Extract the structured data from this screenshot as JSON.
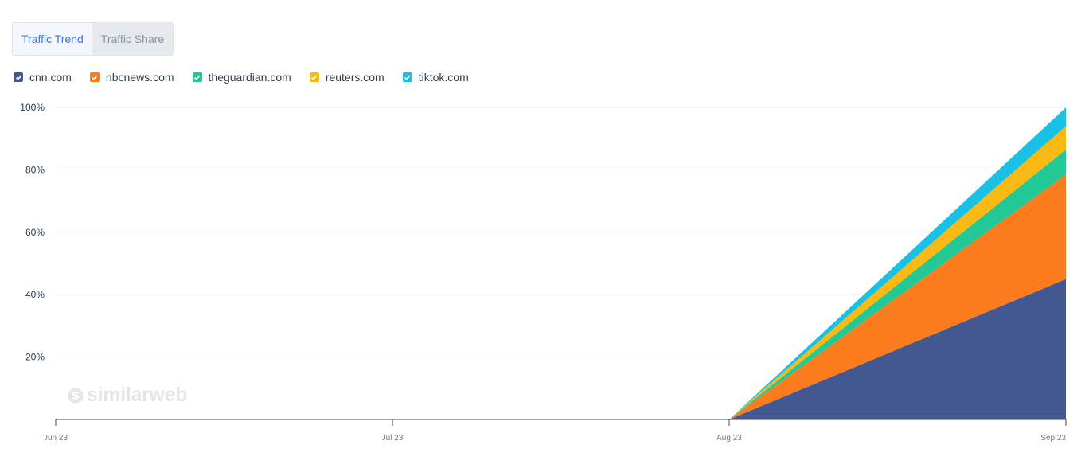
{
  "tabs": [
    {
      "label": "Traffic Trend",
      "active": true
    },
    {
      "label": "Traffic Share",
      "active": false
    }
  ],
  "legend": [
    {
      "label": "cnn.com",
      "color": "#435891"
    },
    {
      "label": "nbcnews.com",
      "color": "#fc7c1d"
    },
    {
      "label": "theguardian.com",
      "color": "#22c994"
    },
    {
      "label": "reuters.com",
      "color": "#fbb913"
    },
    {
      "label": "tiktok.com",
      "color": "#18c1e5"
    }
  ],
  "watermark": {
    "text": "similarweb"
  },
  "chart_data": {
    "type": "area",
    "stacked": true,
    "x": [
      "Jun 23",
      "Jul 23",
      "Aug 23",
      "Sep 23"
    ],
    "series": [
      {
        "name": "cnn.com",
        "color": "#435891",
        "values": [
          0,
          0,
          0,
          45
        ]
      },
      {
        "name": "nbcnews.com",
        "color": "#fc7c1d",
        "values": [
          0,
          0,
          0,
          33.5
        ]
      },
      {
        "name": "theguardian.com",
        "color": "#22c994",
        "values": [
          0,
          0,
          0,
          8
        ]
      },
      {
        "name": "reuters.com",
        "color": "#fbb913",
        "values": [
          0,
          0,
          0,
          7.5
        ]
      },
      {
        "name": "tiktok.com",
        "color": "#18c1e5",
        "values": [
          0,
          0,
          0,
          6
        ]
      }
    ],
    "y_ticks": [
      "20%",
      "40%",
      "60%",
      "80%",
      "100%"
    ],
    "ylim": [
      0,
      100
    ],
    "grid": true,
    "legend_position": "top-left"
  }
}
